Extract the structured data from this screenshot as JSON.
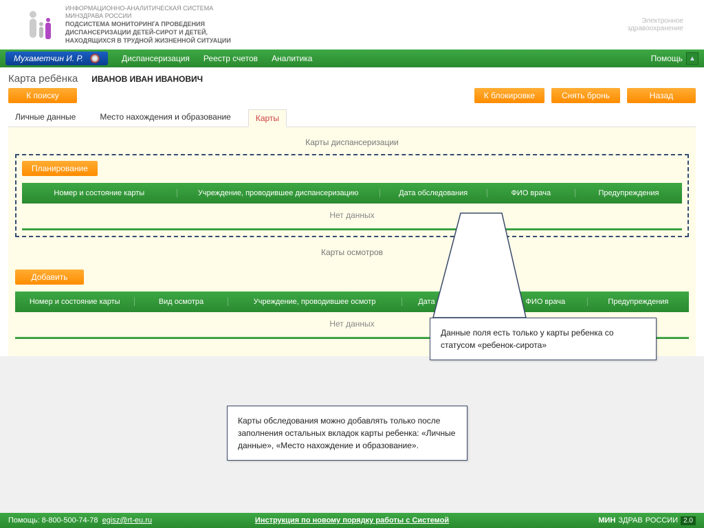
{
  "header": {
    "system_line1": "ИНФОРМАЦИОННО-АНАЛИТИЧЕСКАЯ СИСТЕМА",
    "system_line2": "МИНЗДРАВА РОССИИ",
    "sub_line1": "ПОДСИСТЕМА МОНИТОРИНГА ПРОВЕДЕНИЯ",
    "sub_line2": "ДИСПАНСЕРИЗАЦИИ ДЕТЕЙ-СИРОТ И ДЕТЕЙ,",
    "sub_line3": "НАХОДЯЩИХСЯ В ТРУДНОЙ ЖИЗНЕННОЙ СИТУАЦИИ",
    "right_line1": "Электронное",
    "right_line2": "здравоохранение"
  },
  "menu": {
    "user": "Мухаметчин И. Р.",
    "items": [
      "Диспансеризация",
      "Реестр счетов",
      "Аналитика"
    ],
    "help": "Помощь"
  },
  "page": {
    "title": "Карта ребёнка",
    "patient": "ИВАНОВ ИВАН ИВАНОВИЧ"
  },
  "buttons": {
    "search": "К поиску",
    "lock": "К блокировке",
    "unreserve": "Снять бронь",
    "back": "Назад",
    "planning": "Планирование",
    "add": "Добавить"
  },
  "tabs": [
    "Личные данные",
    "Место нахождения и образование",
    "Карты"
  ],
  "section1": {
    "title": "Карты диспансеризации",
    "cols": [
      "Номер и состояние карты",
      "Учреждение, проводившее диспансеризацию",
      "Дата обследования",
      "ФИО врача",
      "Предупреждения"
    ],
    "empty": "Нет данных"
  },
  "section2": {
    "title": "Карты осмотров",
    "cols": [
      "Номер и состояние карты",
      "Вид осмотра",
      "Учреждение, проводившее осмотр",
      "Дата обследования",
      "ФИО врача",
      "Предупреждения"
    ],
    "empty": "Нет данных"
  },
  "callouts": {
    "c1": "Данные поля есть только у карты ребенка со статусом «ребенок-сирота»",
    "c2": "Карты обследования можно добавлять только после заполнения остальных вкладок карты ребенка: «Личные данные», «Место нахождение и образование»."
  },
  "footer": {
    "help": "Помощь: 8-800-500-74-78",
    "email": "egisz@rt-eu.ru",
    "instruction": "Инструкция по новому порядку работы с Системой",
    "brand1": "МИН",
    "brand2": "ЗДРАВ",
    "brand3": " РОССИИ",
    "version": "2.0"
  }
}
